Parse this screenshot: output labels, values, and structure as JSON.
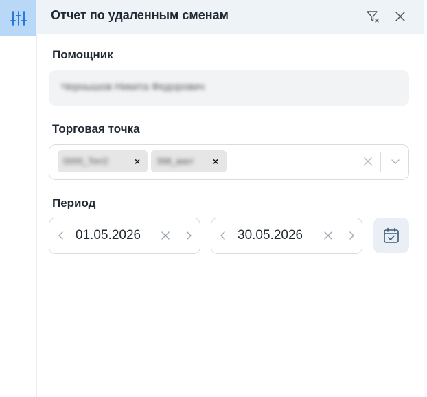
{
  "header": {
    "title": "Отчет по удаленным сменам"
  },
  "fields": {
    "assistant": {
      "label": "Помощник",
      "value": "Чернышов Никита Федорович"
    },
    "outlet": {
      "label": "Торговая точка",
      "chips": [
        "0000_Torr2",
        "398_магг"
      ]
    },
    "period": {
      "label": "Период",
      "from": "01.05.2026",
      "to": "30.05.2026"
    }
  },
  "icons": {
    "rail": "sliders-icon",
    "filter_clear": "filter-clear-icon",
    "close": "close-icon",
    "calendar": "calendar-check-icon"
  },
  "colors": {
    "accent": "#1b6fd6",
    "rail_active": "#b9d8f7",
    "header_bg": "#eef3f8"
  }
}
